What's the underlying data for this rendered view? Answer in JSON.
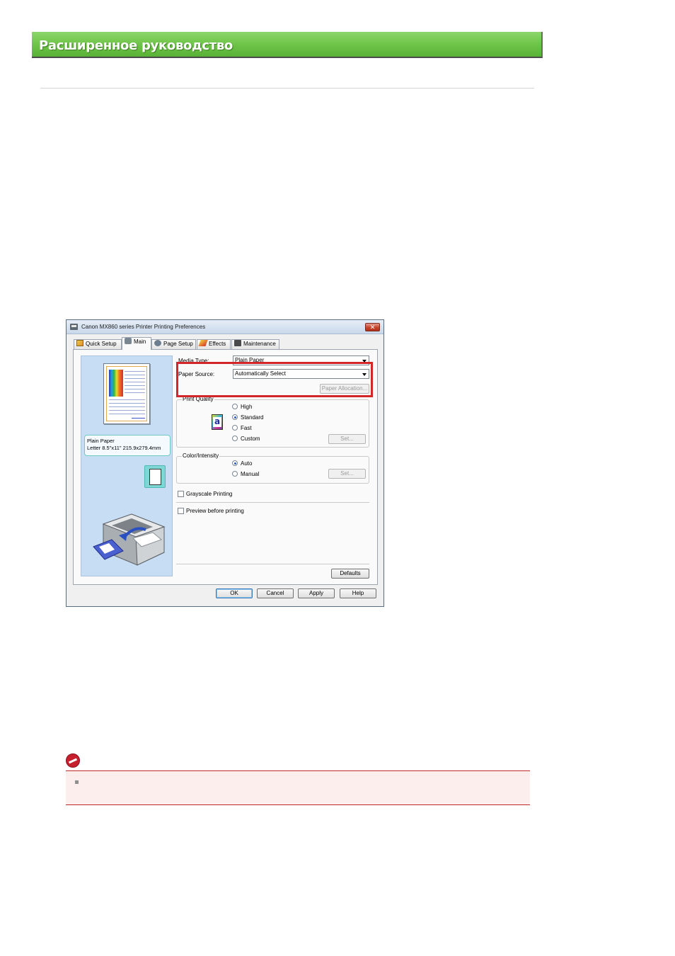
{
  "header": {
    "title": "Расширенное руководство"
  },
  "dialog": {
    "title": "Canon MX860 series Printer Printing Preferences",
    "close_glyph": "✕",
    "tabs": [
      {
        "label": "Quick Setup",
        "icon": "quick-setup-icon"
      },
      {
        "label": "Main",
        "icon": "main-icon"
      },
      {
        "label": "Page Setup",
        "icon": "page-setup-icon"
      },
      {
        "label": "Effects",
        "icon": "effects-icon"
      },
      {
        "label": "Maintenance",
        "icon": "maintenance-icon"
      }
    ],
    "active_tab": "Main",
    "preview": {
      "media_info_line1": "Plain Paper",
      "media_info_line2": "Letter 8.5\"x11\" 215.9x279.4mm"
    },
    "media_type": {
      "label": "Media Type:",
      "value": "Plain Paper"
    },
    "paper_source": {
      "label": "Paper Source:",
      "value": "Automatically Select"
    },
    "paper_allocation_button": "Paper Allocation...",
    "print_quality": {
      "label": "Print Quality",
      "icon_glyph": "a",
      "options": [
        "High",
        "Standard",
        "Fast",
        "Custom"
      ],
      "selected": "Standard",
      "set_button": "Set..."
    },
    "color_intensity": {
      "label": "Color/Intensity",
      "options": [
        "Auto",
        "Manual"
      ],
      "selected": "Auto",
      "set_button": "Set..."
    },
    "grayscale_printing": {
      "label": "Grayscale Printing",
      "checked": false
    },
    "preview_before_printing": {
      "label": "Preview before printing",
      "checked": false
    },
    "defaults_button": "Defaults",
    "footer_buttons": {
      "ok": "OK",
      "cancel": "Cancel",
      "apply": "Apply",
      "help": "Help"
    }
  },
  "highlight_color": "#d2262b",
  "accent_green": "#6cc246",
  "note": {
    "icon": "important-icon",
    "bullet_color": "#8f8f8f"
  }
}
